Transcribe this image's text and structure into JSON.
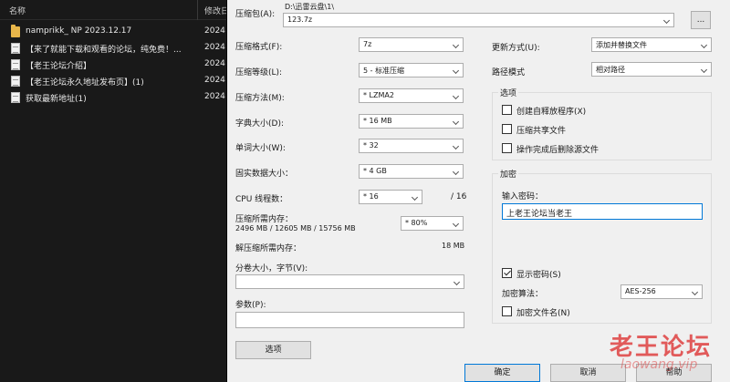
{
  "explorer": {
    "col_name": "名称",
    "col_date": "修改日",
    "rows": [
      {
        "name": "namprikk_ NP 2023.12.17",
        "date": "2024",
        "icon": "folder-icon"
      },
      {
        "name": "【来了就能下载和观看的论坛，纯免费！...",
        "date": "2024",
        "icon": "file-icon"
      },
      {
        "name": "【老王论坛介绍】",
        "date": "2024",
        "icon": "file-icon"
      },
      {
        "name": "【老王论坛永久地址发布页】(1)",
        "date": "2024",
        "icon": "file-icon"
      },
      {
        "name": "获取最新地址(1)",
        "date": "2024",
        "icon": "file-icon"
      }
    ]
  },
  "dialog": {
    "archive_label": "压缩包(A):",
    "archive_path": "D:\\迅雷云盘\\1\\",
    "archive_name": "123.7z",
    "browse_label": "...",
    "format_label": "压缩格式(F):",
    "format_value": "7z",
    "level_label": "压缩等级(L):",
    "level_value": "5 - 标准压缩",
    "method_label": "压缩方法(M):",
    "method_value": "* LZMA2",
    "dict_label": "字典大小(D):",
    "dict_value": "* 16 MB",
    "word_label": "单词大小(W):",
    "word_value": "* 32",
    "solid_label": "固实数据大小：",
    "solid_value": "* 4 GB",
    "cpu_label": "CPU 线程数：",
    "cpu_value": "* 16",
    "cpu_total": "/ 16",
    "mem_label": "压缩所需内存：",
    "mem_detail": "2496 MB / 12605 MB / 15756 MB",
    "mem_percent": "* 80%",
    "decomp_label": "解压缩所需内存：",
    "decomp_value": "18 MB",
    "split_label": "分卷大小，字节(V):",
    "params_label": "参数(P):",
    "options_button": "选项",
    "update_label": "更新方式(U):",
    "update_value": "添加并替换文件",
    "pathmode_label": "路径模式",
    "pathmode_value": "相对路径",
    "options_group": "选项",
    "opt_sfx": "创建自释放程序(X)",
    "opt_shared": "压缩共享文件",
    "opt_delete": "操作完成后删除源文件",
    "encrypt_group": "加密",
    "password_label": "输入密码：",
    "password_value": "上老王论坛当老王",
    "show_password": "显示密码(S)",
    "enc_method_label": "加密算法：",
    "enc_method_value": "AES-256",
    "encrypt_names": "加密文件名(N)",
    "ok_button": "确定",
    "cancel_button": "取消",
    "help_button": "帮助"
  },
  "watermark": {
    "text": "老王论坛",
    "url": "laowang.vip"
  }
}
